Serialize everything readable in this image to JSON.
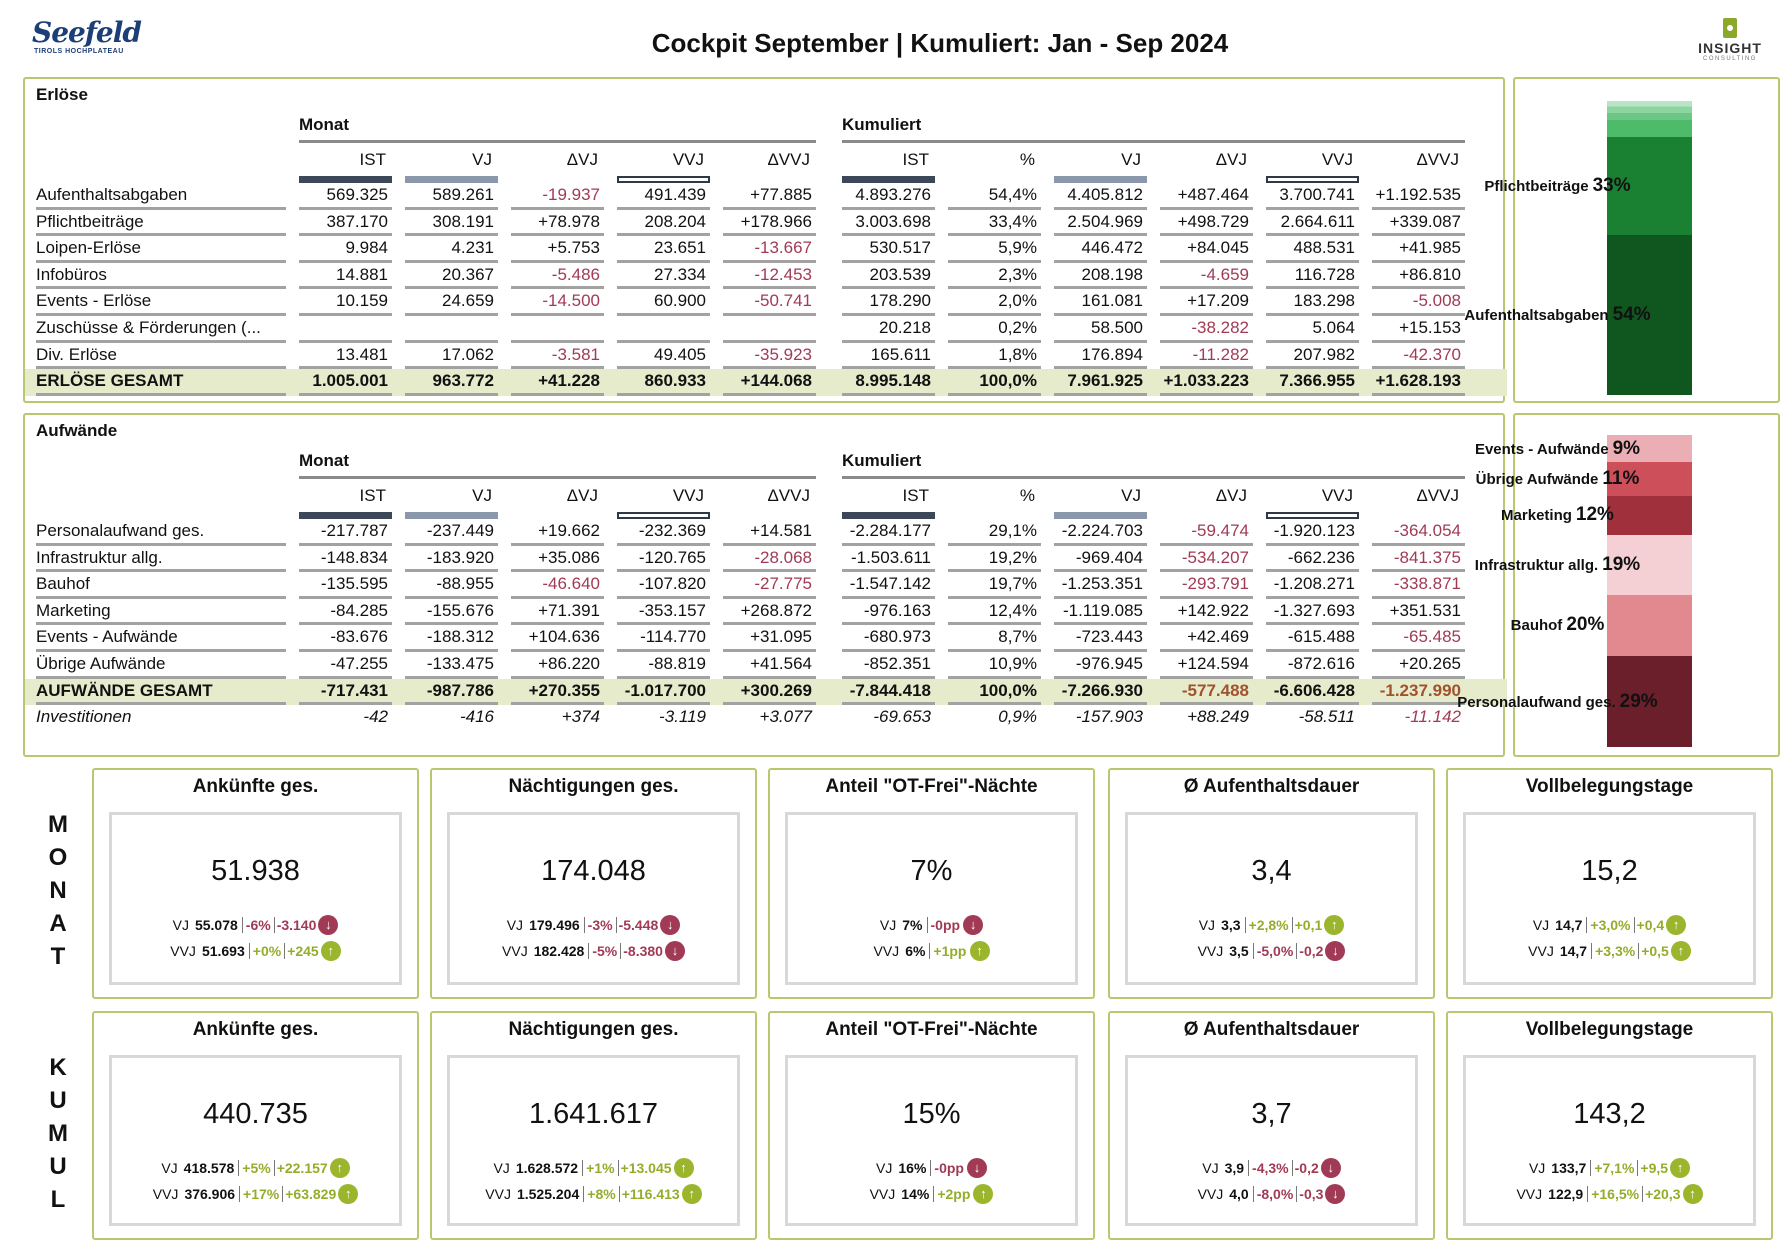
{
  "header": {
    "title": "Cockpit September | Kumuliert: Jan - Sep 2024",
    "logo_left": {
      "brand": "Seefeld",
      "sub": "TIROLS HOCHPLATEAU"
    },
    "logo_right": {
      "brand": "INSIGHT",
      "sub": "CONSULTING"
    }
  },
  "colors": {
    "panel_border": "#b9c86e",
    "negative": "#a13a55",
    "positive": "#9bb52c",
    "total_row_bg": "#e6ebcc"
  },
  "tables": [
    {
      "title": "Erlöse",
      "group_monat": "Monat",
      "group_kumuliert": "Kumuliert",
      "columns_monat": [
        "IST",
        "VJ",
        "ΔVJ",
        "VVJ",
        "ΔVVJ"
      ],
      "columns_kumuliert": [
        "IST",
        "%",
        "VJ",
        "ΔVJ",
        "VVJ",
        "ΔVVJ"
      ],
      "rows": [
        {
          "label": "Aufenthaltsabgaben",
          "monat": [
            "569.325",
            "589.261",
            "-19.937",
            "491.439",
            "+77.885"
          ],
          "kumuliert": [
            "4.893.276",
            "54,4%",
            "4.405.812",
            "+487.464",
            "3.700.741",
            "+1.192.535"
          ]
        },
        {
          "label": "Pflichtbeiträge",
          "monat": [
            "387.170",
            "308.191",
            "+78.978",
            "208.204",
            "+178.966"
          ],
          "kumuliert": [
            "3.003.698",
            "33,4%",
            "2.504.969",
            "+498.729",
            "2.664.611",
            "+339.087"
          ]
        },
        {
          "label": "Loipen-Erlöse",
          "monat": [
            "9.984",
            "4.231",
            "+5.753",
            "23.651",
            "-13.667"
          ],
          "kumuliert": [
            "530.517",
            "5,9%",
            "446.472",
            "+84.045",
            "488.531",
            "+41.985"
          ]
        },
        {
          "label": "Infobüros",
          "monat": [
            "14.881",
            "20.367",
            "-5.486",
            "27.334",
            "-12.453"
          ],
          "kumuliert": [
            "203.539",
            "2,3%",
            "208.198",
            "-4.659",
            "116.728",
            "+86.810"
          ]
        },
        {
          "label": "Events - Erlöse",
          "monat": [
            "10.159",
            "24.659",
            "-14.500",
            "60.900",
            "-50.741"
          ],
          "kumuliert": [
            "178.290",
            "2,0%",
            "161.081",
            "+17.209",
            "183.298",
            "-5.008"
          ]
        },
        {
          "label": "Zuschüsse & Förderungen (...",
          "monat": [
            "",
            "",
            "",
            "",
            ""
          ],
          "kumuliert": [
            "20.218",
            "0,2%",
            "58.500",
            "-38.282",
            "5.064",
            "+15.153"
          ]
        },
        {
          "label": "Div. Erlöse",
          "monat": [
            "13.481",
            "17.062",
            "-3.581",
            "49.405",
            "-35.923"
          ],
          "kumuliert": [
            "165.611",
            "1,8%",
            "176.894",
            "-11.282",
            "207.982",
            "-42.370"
          ]
        }
      ],
      "total": {
        "label": "ERLÖSE GESAMT",
        "monat": [
          "1.005.001",
          "963.772",
          "+41.228",
          "860.933",
          "+144.068"
        ],
        "kumuliert": [
          "8.995.148",
          "100,0%",
          "7.961.925",
          "+1.033.223",
          "7.366.955",
          "+1.628.193"
        ]
      }
    },
    {
      "title": "Aufwände",
      "group_monat": "Monat",
      "group_kumuliert": "Kumuliert",
      "columns_monat": [
        "IST",
        "VJ",
        "ΔVJ",
        "VVJ",
        "ΔVVJ"
      ],
      "columns_kumuliert": [
        "IST",
        "%",
        "VJ",
        "ΔVJ",
        "VVJ",
        "ΔVVJ"
      ],
      "rows": [
        {
          "label": "Personalaufwand ges.",
          "monat": [
            "-217.787",
            "-237.449",
            "+19.662",
            "-232.369",
            "+14.581"
          ],
          "kumuliert": [
            "-2.284.177",
            "29,1%",
            "-2.224.703",
            "-59.474",
            "-1.920.123",
            "-364.054"
          ]
        },
        {
          "label": "Infrastruktur allg.",
          "monat": [
            "-148.834",
            "-183.920",
            "+35.086",
            "-120.765",
            "-28.068"
          ],
          "kumuliert": [
            "-1.503.611",
            "19,2%",
            "-969.404",
            "-534.207",
            "-662.236",
            "-841.375"
          ]
        },
        {
          "label": "Bauhof",
          "monat": [
            "-135.595",
            "-88.955",
            "-46.640",
            "-107.820",
            "-27.775"
          ],
          "kumuliert": [
            "-1.547.142",
            "19,7%",
            "-1.253.351",
            "-293.791",
            "-1.208.271",
            "-338.871"
          ]
        },
        {
          "label": "Marketing",
          "monat": [
            "-84.285",
            "-155.676",
            "+71.391",
            "-353.157",
            "+268.872"
          ],
          "kumuliert": [
            "-976.163",
            "12,4%",
            "-1.119.085",
            "+142.922",
            "-1.327.693",
            "+351.531"
          ]
        },
        {
          "label": "Events - Aufwände",
          "monat": [
            "-83.676",
            "-188.312",
            "+104.636",
            "-114.770",
            "+31.095"
          ],
          "kumuliert": [
            "-680.973",
            "8,7%",
            "-723.443",
            "+42.469",
            "-615.488",
            "-65.485"
          ]
        },
        {
          "label": "Übrige Aufwände",
          "monat": [
            "-47.255",
            "-133.475",
            "+86.220",
            "-88.819",
            "+41.564"
          ],
          "kumuliert": [
            "-852.351",
            "10,9%",
            "-976.945",
            "+124.594",
            "-872.616",
            "+20.265"
          ]
        }
      ],
      "total": {
        "label": "AUFWÄNDE GESAMT",
        "monat": [
          "-717.431",
          "-987.786",
          "+270.355",
          "-1.017.700",
          "+300.269"
        ],
        "kumuliert": [
          "-7.844.418",
          "100,0%",
          "-7.266.930",
          "-577.488",
          "-6.606.428",
          "-1.237.990"
        ]
      },
      "extra": {
        "label": "Investitionen",
        "monat": [
          "-42",
          "-416",
          "+374",
          "-3.119",
          "+3.077"
        ],
        "kumuliert": [
          "-69.653",
          "0,9%",
          "-157.903",
          "+88.249",
          "-58.511",
          "-11.142"
        ]
      }
    }
  ],
  "share_bars": [
    {
      "segments": [
        {
          "name": "Aufenthaltsabgaben",
          "value": 54.4,
          "label": "Aufenthaltsabgaben",
          "pct_label": "54%",
          "color": "#10561f"
        },
        {
          "name": "Pflichtbeiträge",
          "value": 33.4,
          "label": "Pflichtbeiträge",
          "pct_label": "33%",
          "color": "#1a8032"
        },
        {
          "name": "Loipen-Erlöse",
          "value": 5.9,
          "color": "#4dbb69"
        },
        {
          "name": "Infobüros",
          "value": 2.3,
          "color": "#6cc785"
        },
        {
          "name": "Events - Erlöse",
          "value": 2.0,
          "color": "#8cd4a0"
        },
        {
          "name": "Zuschüsse & Förderungen",
          "value": 0.2,
          "color": "#a5ddb4"
        },
        {
          "name": "Div. Erlöse",
          "value": 1.8,
          "color": "#b8e5c3"
        }
      ]
    },
    {
      "segments": [
        {
          "name": "Personalaufwand ges.",
          "value": 29.1,
          "label": "Personalaufwand ges.",
          "pct_label": "29%",
          "color": "#6b1f2a"
        },
        {
          "name": "Bauhof",
          "value": 19.7,
          "label": "Bauhof",
          "pct_label": "20%",
          "color": "#e28990"
        },
        {
          "name": "Infrastruktur allg.",
          "value": 19.2,
          "label": "Infrastruktur allg.",
          "pct_label": "19%",
          "color": "#f4cfd3"
        },
        {
          "name": "Marketing",
          "value": 12.4,
          "label": "Marketing",
          "pct_label": "12%",
          "color": "#a1303d"
        },
        {
          "name": "Übrige Aufwände",
          "value": 10.9,
          "label": "Übrige Aufwände",
          "pct_label": "11%",
          "color": "#cc4f5a"
        },
        {
          "name": "Events - Aufwände",
          "value": 8.7,
          "label": "Events - Aufwände",
          "pct_label": "9%",
          "color": "#eaaeb4"
        }
      ]
    }
  ],
  "kpi_rows": [
    {
      "label": "MONAT",
      "cards": [
        {
          "title": "Ankünfte ges.",
          "value": "51.938",
          "comparisons": [
            {
              "label": "VJ",
              "value": "55.078",
              "pct": "-6%",
              "diff": "-3.140",
              "direction": "down"
            },
            {
              "label": "VVJ",
              "value": "51.693",
              "pct": "+0%",
              "diff": "+245",
              "direction": "up"
            }
          ]
        },
        {
          "title": "Nächtigungen ges.",
          "value": "174.048",
          "comparisons": [
            {
              "label": "VJ",
              "value": "179.496",
              "pct": "-3%",
              "diff": "-5.448",
              "direction": "down"
            },
            {
              "label": "VVJ",
              "value": "182.428",
              "pct": "-5%",
              "diff": "-8.380",
              "direction": "down"
            }
          ]
        },
        {
          "title": "Anteil \"OT-Frei\"-Nächte",
          "value": "7%",
          "comparisons": [
            {
              "label": "VJ",
              "value": "7%",
              "pct": "-0pp",
              "diff": "",
              "direction": "down"
            },
            {
              "label": "VVJ",
              "value": "6%",
              "pct": "+1pp",
              "diff": "",
              "direction": "up"
            }
          ]
        },
        {
          "title": "Ø Aufenthaltsdauer",
          "value": "3,4",
          "comparisons": [
            {
              "label": "VJ",
              "value": "3,3",
              "pct": "+2,8%",
              "diff": "+0,1",
              "direction": "up"
            },
            {
              "label": "VVJ",
              "value": "3,5",
              "pct": "-5,0%",
              "diff": "-0,2",
              "direction": "down"
            }
          ]
        },
        {
          "title": "Vollbelegungstage",
          "value": "15,2",
          "comparisons": [
            {
              "label": "VJ",
              "value": "14,7",
              "pct": "+3,0%",
              "diff": "+0,4",
              "direction": "up"
            },
            {
              "label": "VVJ",
              "value": "14,7",
              "pct": "+3,3%",
              "diff": "+0,5",
              "direction": "up"
            }
          ]
        }
      ]
    },
    {
      "label": "KUMUL",
      "cards": [
        {
          "title": "Ankünfte ges.",
          "value": "440.735",
          "comparisons": [
            {
              "label": "VJ",
              "value": "418.578",
              "pct": "+5%",
              "diff": "+22.157",
              "direction": "up"
            },
            {
              "label": "VVJ",
              "value": "376.906",
              "pct": "+17%",
              "diff": "+63.829",
              "direction": "up"
            }
          ]
        },
        {
          "title": "Nächtigungen ges.",
          "value": "1.641.617",
          "comparisons": [
            {
              "label": "VJ",
              "value": "1.628.572",
              "pct": "+1%",
              "diff": "+13.045",
              "direction": "up"
            },
            {
              "label": "VVJ",
              "value": "1.525.204",
              "pct": "+8%",
              "diff": "+116.413",
              "direction": "up"
            }
          ]
        },
        {
          "title": "Anteil \"OT-Frei\"-Nächte",
          "value": "15%",
          "comparisons": [
            {
              "label": "VJ",
              "value": "16%",
              "pct": "-0pp",
              "diff": "",
              "direction": "down"
            },
            {
              "label": "VVJ",
              "value": "14%",
              "pct": "+2pp",
              "diff": "",
              "direction": "up"
            }
          ]
        },
        {
          "title": "Ø Aufenthaltsdauer",
          "value": "3,7",
          "comparisons": [
            {
              "label": "VJ",
              "value": "3,9",
              "pct": "-4,3%",
              "diff": "-0,2",
              "direction": "down"
            },
            {
              "label": "VVJ",
              "value": "4,0",
              "pct": "-8,0%",
              "diff": "-0,3",
              "direction": "down"
            }
          ]
        },
        {
          "title": "Vollbelegungstage",
          "value": "143,2",
          "comparisons": [
            {
              "label": "VJ",
              "value": "133,7",
              "pct": "+7,1%",
              "diff": "+9,5",
              "direction": "up"
            },
            {
              "label": "VVJ",
              "value": "122,9",
              "pct": "+16,5%",
              "diff": "+20,3",
              "direction": "up"
            }
          ]
        }
      ]
    }
  ]
}
